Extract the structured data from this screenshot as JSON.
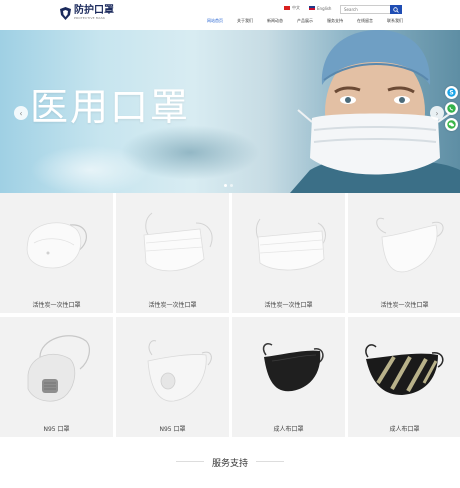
{
  "header": {
    "logo_cn": "防护口罩",
    "logo_en": "PROTECTIVE MASK",
    "langs": [
      {
        "label": "中文",
        "flag": "cn"
      },
      {
        "label": "English",
        "flag": "en"
      }
    ],
    "search_placeholder": "Search",
    "nav": [
      {
        "label": "网站首页",
        "active": true
      },
      {
        "label": "关于我们",
        "active": false
      },
      {
        "label": "新闻动态",
        "active": false
      },
      {
        "label": "产品展示",
        "active": false
      },
      {
        "label": "服务支持",
        "active": false
      },
      {
        "label": "在线留言",
        "active": false
      },
      {
        "label": "联系我们",
        "active": false
      }
    ]
  },
  "banner": {
    "title": "医用口罩",
    "slide_count": 2,
    "active_slide": 1
  },
  "products": [
    {
      "label": "活性炭一次性口罩",
      "kind": "cup-white"
    },
    {
      "label": "活性炭一次性口罩",
      "kind": "flat-white"
    },
    {
      "label": "活性炭一次性口罩",
      "kind": "flat-white-2"
    },
    {
      "label": "活性炭一次性口罩",
      "kind": "shaped-white"
    },
    {
      "label": "N95 口罩",
      "kind": "valve-gray"
    },
    {
      "label": "N95 口罩",
      "kind": "valve-white"
    },
    {
      "label": "成人布口罩",
      "kind": "cloth-black"
    },
    {
      "label": "成人布口罩",
      "kind": "cloth-stripe"
    }
  ],
  "service": {
    "title": "服务支持"
  },
  "colors": {
    "accent": "#1f5fd1",
    "search_button": "#1f4db3",
    "logo": "#1b2a5c"
  }
}
